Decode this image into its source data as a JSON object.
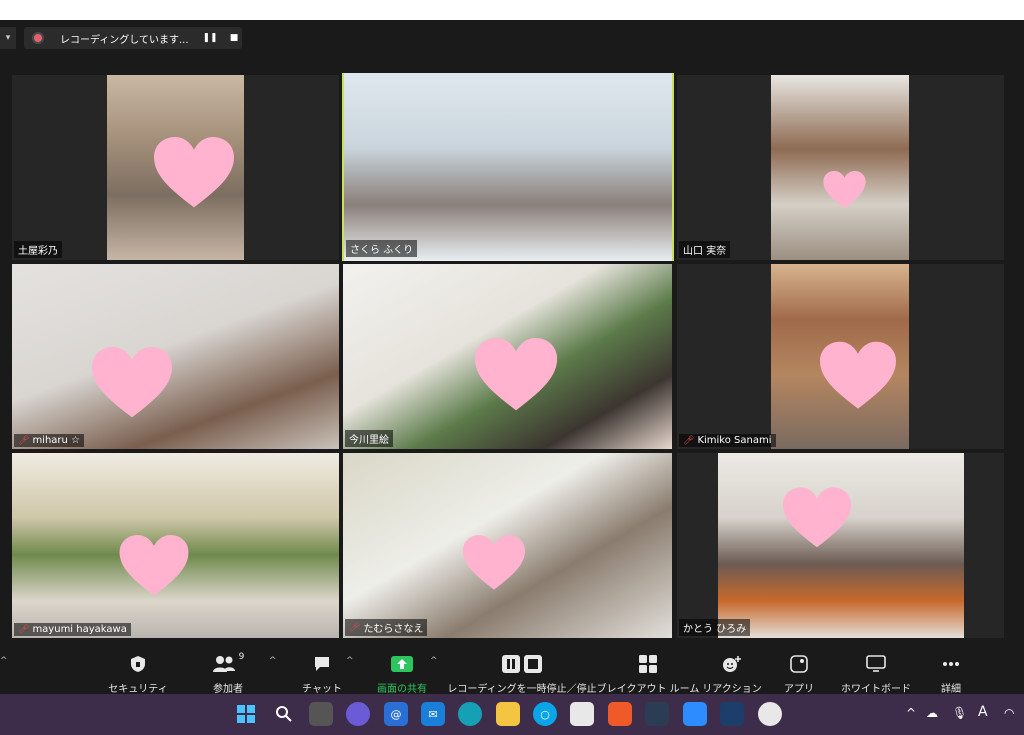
{
  "recording": {
    "status_text": "レコーディングしています..."
  },
  "participants": [
    {
      "name": "土屋彩乃",
      "muted": false,
      "active": false
    },
    {
      "name": "さくら ふくり",
      "muted": false,
      "active": true
    },
    {
      "name": "山口 実奈",
      "muted": false,
      "active": false
    },
    {
      "name": "miharu ☆",
      "muted": true,
      "active": false
    },
    {
      "name": "今川里絵",
      "muted": false,
      "active": false
    },
    {
      "name": "Kimiko Sanami",
      "muted": true,
      "active": false
    },
    {
      "name": "mayumi hayakawa",
      "muted": true,
      "active": false
    },
    {
      "name": "たむらさなえ",
      "muted": true,
      "active": false
    },
    {
      "name": "かとう ひろみ",
      "muted": false,
      "active": false
    }
  ],
  "toolbar": {
    "security": "セキュリティ",
    "participants": "参加者",
    "participants_count": "9",
    "chat": "チャット",
    "share": "画面の共有",
    "recording": "レコーディングを一時停止／停止",
    "breakout": "ブレイクアウト ルーム",
    "reactions": "リアクション",
    "apps": "アプリ",
    "whiteboard": "ホワイトボード",
    "more": "詳細"
  },
  "colors": {
    "active_speaker_border": "#c8e05a",
    "share_accent": "#2dc55e",
    "muted_mic": "#e04848",
    "heart": "#ffb3cf",
    "taskbar": "#3d2c4a"
  }
}
